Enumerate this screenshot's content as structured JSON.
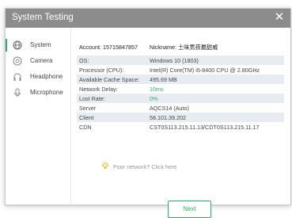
{
  "window": {
    "title": "System Testing",
    "close_icon": "close-icon"
  },
  "sidebar": {
    "items": [
      {
        "label": "System",
        "icon": "globe-icon",
        "active": true
      },
      {
        "label": "Camera",
        "icon": "camera-icon",
        "active": false
      },
      {
        "label": "Headphone",
        "icon": "headphone-icon",
        "active": false
      },
      {
        "label": "Microphone",
        "icon": "microphone-icon",
        "active": false
      }
    ]
  },
  "main": {
    "account_label": "Account: 15715847857",
    "nickname_label": "Nickname: 土味男孩最甜威",
    "rows": [
      {
        "key": "OS:",
        "value": "Windows 10 (1803)"
      },
      {
        "key": "Processor (CPU):",
        "value": "Intel(R) Core(TM) i5-8400 CPU @ 2.80GHz"
      },
      {
        "key": "Available Cache Space:",
        "value": "495.69 MB"
      },
      {
        "key": "Network Delay:",
        "value": "10ms"
      },
      {
        "key": "Lost Rate:",
        "value": "0%"
      },
      {
        "key": "Server",
        "value": "AQCS14 (Auto)"
      },
      {
        "key": "Client",
        "value": "58.101.39.202"
      },
      {
        "key": "CDN",
        "value": "CST0S113.215.11.13/CDT0S113.215.11.17"
      }
    ],
    "poor_network_text": "Poor network? Click here",
    "next_label": "Next"
  },
  "colors": {
    "accent": "#2aae67",
    "title_bar": "#8c8c8c",
    "row_shade": "#e8ecf1"
  }
}
